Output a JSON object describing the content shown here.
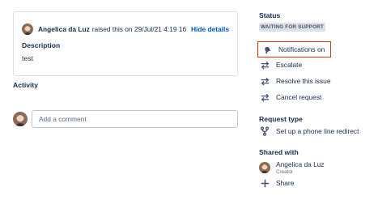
{
  "request": {
    "raiser_name": "Angelica da Luz",
    "raised_text": "raised this on 29/Jul/21 4:19 16",
    "hide_details_label": "Hide details",
    "description_label": "Description",
    "description_value": "test"
  },
  "activity": {
    "title": "Activity",
    "comment_placeholder": "Add a comment"
  },
  "sidebar": {
    "status_title": "Status",
    "status_value": "WAITING FOR SUPPORT",
    "actions": [
      {
        "label": "Notifications on",
        "icon": "bell-icon"
      },
      {
        "label": "Escalate",
        "icon": "swap-arrows-icon"
      },
      {
        "label": "Resolve this issue",
        "icon": "swap-arrows-icon"
      },
      {
        "label": "Cancel request",
        "icon": "swap-arrows-icon"
      }
    ],
    "request_type_title": "Request type",
    "request_type_value": "Set up a phone line redirect",
    "shared_with_title": "Shared with",
    "shared_person_name": "Angelica da Luz",
    "shared_person_role": "Creator",
    "share_label": "Share"
  },
  "colors": {
    "link": "#0052cc",
    "highlight_border": "#de350b",
    "badge_bg": "#dfe1e6"
  }
}
